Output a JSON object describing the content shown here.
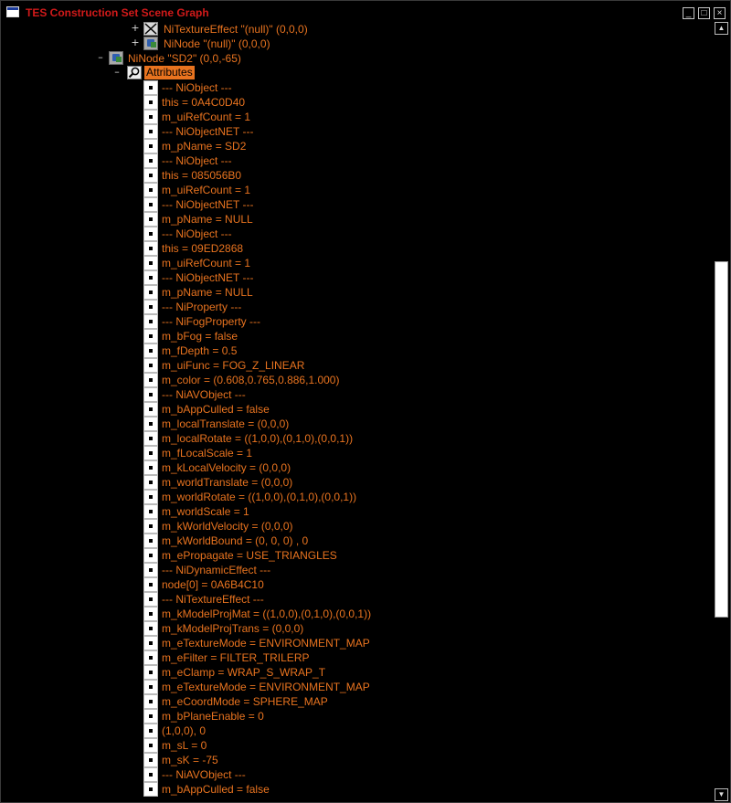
{
  "window": {
    "title": "TES Construction Set Scene Graph",
    "buttons": {
      "minimize": "_",
      "maximize": "□",
      "close": "×"
    }
  },
  "tree": {
    "parent_rows": [
      {
        "expander": "+",
        "icon": "texture-effect-icon",
        "label": "NiTextureEffect \"(null)\" (0,0,0)"
      },
      {
        "expander": "+",
        "icon": "ninode-icon",
        "label": "NiNode \"(null)\" (0,0,0)"
      },
      {
        "expander": "–",
        "icon": "ninode-icon",
        "label": "NiNode \"SD2\" (0,0,-65)"
      },
      {
        "expander": "–",
        "icon": "search-icon",
        "label": "Attributes"
      }
    ],
    "attributes": [
      "--- NiObject ---",
      "this = 0A4C0D40",
      "m_uiRefCount = 1",
      "--- NiObjectNET ---",
      "m_pName = SD2",
      "--- NiObject ---",
      "this = 085056B0",
      "m_uiRefCount = 1",
      "--- NiObjectNET ---",
      "m_pName = NULL",
      "--- NiObject ---",
      "this = 09ED2868",
      "m_uiRefCount = 1",
      "--- NiObjectNET ---",
      "m_pName = NULL",
      "--- NiProperty ---",
      "--- NiFogProperty ---",
      "m_bFog = false",
      "m_fDepth = 0.5",
      "m_uiFunc = FOG_Z_LINEAR",
      "m_color = (0.608,0.765,0.886,1.000)",
      "--- NiAVObject ---",
      "m_bAppCulled = false",
      "m_localTranslate = (0,0,0)",
      "m_localRotate = ((1,0,0),(0,1,0),(0,0,1))",
      "m_fLocalScale = 1",
      "m_kLocalVelocity = (0,0,0)",
      "m_worldTranslate = (0,0,0)",
      "m_worldRotate = ((1,0,0),(0,1,0),(0,0,1))",
      "m_worldScale = 1",
      "m_kWorldVelocity = (0,0,0)",
      "m_kWorldBound = (0, 0, 0) , 0",
      "m_ePropagate = USE_TRIANGLES",
      "--- NiDynamicEffect ---",
      "node[0] = 0A6B4C10",
      "--- NiTextureEffect ---",
      "m_kModelProjMat = ((1,0,0),(0,1,0),(0,0,1))",
      "m_kModelProjTrans = (0,0,0)",
      "m_eTextureMode = ENVIRONMENT_MAP",
      "m_eFilter = FILTER_TRILERP",
      "m_eClamp = WRAP_S_WRAP_T",
      "m_eTextureMode = ENVIRONMENT_MAP",
      "m_eCoordMode = SPHERE_MAP",
      "m_bPlaneEnable = 0",
      "(1,0,0), 0",
      "m_sL = 0",
      "m_sK = -75",
      "--- NiAVObject ---",
      "m_bAppCulled = false"
    ]
  },
  "scrollbar": {
    "up_arrow": "▲",
    "down_arrow": "▼",
    "scroll_position": 0.57
  }
}
